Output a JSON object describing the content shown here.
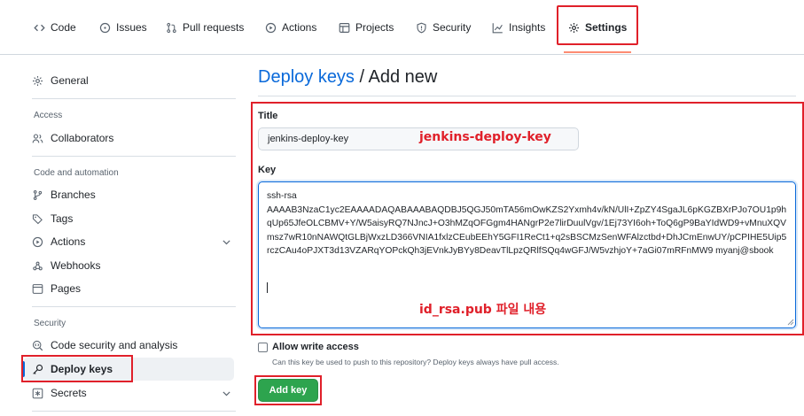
{
  "nav": {
    "tabs": [
      {
        "label": "Code",
        "icon": "code-icon"
      },
      {
        "label": "Issues",
        "icon": "issue-icon"
      },
      {
        "label": "Pull requests",
        "icon": "pull-request-icon"
      },
      {
        "label": "Actions",
        "icon": "play-icon"
      },
      {
        "label": "Projects",
        "icon": "table-icon"
      },
      {
        "label": "Security",
        "icon": "shield-icon"
      },
      {
        "label": "Insights",
        "icon": "graph-icon"
      },
      {
        "label": "Settings",
        "icon": "gear-icon",
        "active": true
      }
    ]
  },
  "sidebar": {
    "general": "General",
    "access_heading": "Access",
    "collaborators": "Collaborators",
    "code_heading": "Code and automation",
    "branches": "Branches",
    "tags": "Tags",
    "actions": "Actions",
    "webhooks": "Webhooks",
    "pages": "Pages",
    "security_heading": "Security",
    "code_security": "Code security and analysis",
    "deploy_keys": "Deploy keys",
    "secrets": "Secrets"
  },
  "page": {
    "crumb_link": "Deploy keys",
    "crumb_sep": " / ",
    "crumb_current": "Add new"
  },
  "form": {
    "title_label": "Title",
    "title_value": "jenkins-deploy-key",
    "key_label": "Key",
    "key_value": "ssh-rsa\nAAAAB3NzaC1yc2EAAAADAQABAAABAQDBJ5QGJ50mTA56mOwKZS2Yxmh4v/kN/UlI+ZpZY4SgaJL6pKGZBXrPJo7OU1p9hqUp65JfeOLCBMV+Y/W5aisyRQ7NJncJ+O3hMZqOFGgm4HANgrP2e7lirDuulVgv/1Ej73YI6oh+ToQ6gP9BaYIdWD9+vMnuXQVmsz7wR10nNAWQtGLBjWxzLD366VNIA1fxlzCEubEEhY5GFI1ReCt1+q2sBSCMzSenWFAlzctbd+DhJCmEnwUY/pCPIHE5Uip5rczCAu4oPJXT3d13VZARqYOPckQh3jEVnkJyBYy8DeavTlLpzQRlfSQq4wGFJ/W5vzhjoY+7aGi07mRFnMW9 myanj@sbook",
    "allow_write_label": "Allow write access",
    "allow_write_help": "Can this key be used to push to this repository? Deploy keys always have pull access.",
    "add_button": "Add key"
  },
  "annotations": {
    "title_note": "jenkins-deploy-key",
    "key_note": "id_rsa.pub 파일 내용",
    "highlight_color": "#e0202a"
  },
  "colors": {
    "accent": "#0969da",
    "button_green": "#2da44e",
    "tab_underline": "#fd8c73"
  }
}
